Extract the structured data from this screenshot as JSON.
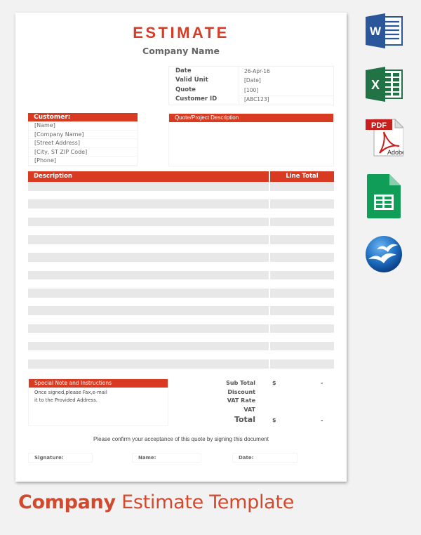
{
  "document": {
    "title": "ESTIMATE",
    "company_name": "Company Name",
    "info": [
      {
        "label": "Date",
        "value": "26-Apr-16"
      },
      {
        "label": "Valid Unit",
        "value": "[Date]"
      },
      {
        "label": "Quote",
        "value": "[100]"
      },
      {
        "label": "Customer ID",
        "value": "[ABC123]"
      }
    ],
    "customer": {
      "header": "Customer:",
      "lines": [
        "[Name]",
        "[Company Name]",
        "[Street Address]",
        "[City, ST ZIP Code]",
        "[Phone]"
      ]
    },
    "quote_description": {
      "header": "Quote/Project Description"
    },
    "items_table": {
      "columns": [
        "Description",
        "Line Total"
      ],
      "row_count": 21
    },
    "notes": {
      "header": "Special Note and Instructions",
      "lines": [
        "Once signed,please Fax,e-mail",
        "it to the Provided Address."
      ]
    },
    "totals": [
      {
        "label": "Sub Total",
        "currency": "$",
        "amount": "-"
      },
      {
        "label": "Discount",
        "currency": "",
        "amount": ""
      },
      {
        "label": "VAT Rate",
        "currency": "",
        "amount": ""
      },
      {
        "label": "VAT",
        "currency": "",
        "amount": ""
      },
      {
        "label": "Total",
        "currency": "$",
        "amount": "-"
      }
    ],
    "confirm_text": "Please confirm your acceptance of this quote by signing this document",
    "signature_fields": [
      "Signature:",
      "Name:",
      "Date:"
    ]
  },
  "caption": {
    "bold": "Company",
    "regular": " Estimate Template"
  },
  "format_icons": [
    {
      "name": "word-icon",
      "label": "W",
      "color": "#2b579a"
    },
    {
      "name": "excel-icon",
      "label": "X",
      "color": "#217346"
    },
    {
      "name": "pdf-icon",
      "label": "PDF",
      "sublabel": "Adobe",
      "color": "#d2232a"
    },
    {
      "name": "google-sheets-icon",
      "label": "",
      "color": "#0f9d58"
    },
    {
      "name": "openoffice-icon",
      "label": "",
      "color": "#1f6fc2"
    }
  ],
  "colors": {
    "accent": "#d93b22",
    "caption": "#d24a2e",
    "row_shade": "#e8e8e8"
  }
}
